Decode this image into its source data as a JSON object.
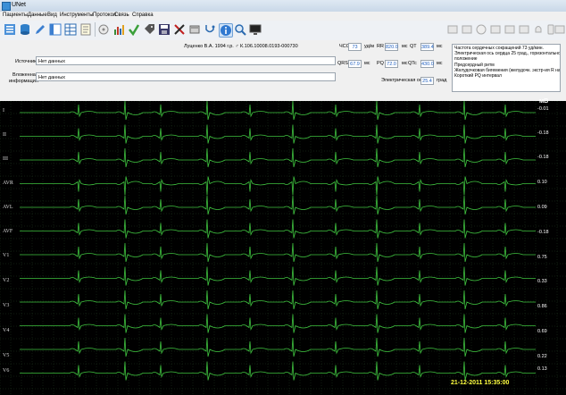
{
  "window": {
    "title": "UNet"
  },
  "menu": [
    "Пациенты",
    "Данные",
    "Вид",
    "Инструменты",
    "Протокол",
    "Связь",
    "Справка"
  ],
  "toolbar": {
    "icons": [
      "list-icon",
      "database-icon",
      "pen-icon",
      "table-icon",
      "table-icon",
      "notes-icon",
      "disk-icon",
      "bar-chart-icon",
      "check-icon",
      "tag-icon",
      "save-icon",
      "cut-icon",
      "eraser-icon",
      "stethoscope-icon",
      "info-icon",
      "search-icon",
      "monitor-icon"
    ],
    "right_icons": [
      "panel-icon",
      "panel-icon",
      "clock-icon",
      "panel-icon",
      "panel-icon",
      "panel-icon",
      "bell-icon",
      "phone-icon",
      "window-icon"
    ]
  },
  "patient": {
    "header": "Луценко В.А. 1994 г.р. ♂ К.106.10008.0193-000730",
    "source_label": "Источник",
    "source_value": "Нет данных",
    "attached_label_1": "Вложенная",
    "attached_label_2": "информация",
    "attached_value": "Нет данных"
  },
  "measures": {
    "hr_label": "ЧСС",
    "hr_value": "73",
    "hr_unit": "уд/м",
    "rr_label": "RR",
    "rr_value": "820.0",
    "rr_unit": "мс",
    "qt_label": "QT",
    "qt_value": "389.4",
    "qt_unit": "мс",
    "qrs_label": "QRS",
    "qrs_value": "67.9",
    "qrs_unit": "мс",
    "pq_label": "PQ",
    "pq_value": "72.0",
    "pq_unit": "мс",
    "qtc_label": "QTc",
    "qtc_value": "430.0",
    "qtc_unit": "мс",
    "axis_label": "Электрическая ось",
    "axis_value": "25.4",
    "axis_unit": "град"
  },
  "conclusion": [
    "Частота сердечных сокращений 73 уд/мин.",
    "Электрическая ось сердца 25 град., горизонтальное",
    "положение",
    "Предсердный ритм",
    "Желудочковая бигемения (желудочк. экстр-ия R на T)",
    "Короткий PQ интервал"
  ],
  "ecg": {
    "unit": "мВ",
    "timestamp": "21-12-2011 15:35:00",
    "trace_color": "#3fc23f",
    "grid_color": "#1e3a1e",
    "leads": [
      {
        "name": "I",
        "mv": "-0.01"
      },
      {
        "name": "II",
        "mv": "-0.18"
      },
      {
        "name": "III",
        "mv": "-0.18"
      },
      {
        "name": "AVR",
        "mv": "0.10"
      },
      {
        "name": "AVL",
        "mv": "0.09"
      },
      {
        "name": "AVF",
        "mv": "-0.18"
      },
      {
        "name": "V1",
        "mv": "0.75"
      },
      {
        "name": "V2",
        "mv": "0.33"
      },
      {
        "name": "V3",
        "mv": "0.86"
      },
      {
        "name": "V4",
        "mv": "0.69"
      },
      {
        "name": "V5",
        "mv": "0.22"
      },
      {
        "name": "V6",
        "mv": "0.13"
      }
    ]
  }
}
